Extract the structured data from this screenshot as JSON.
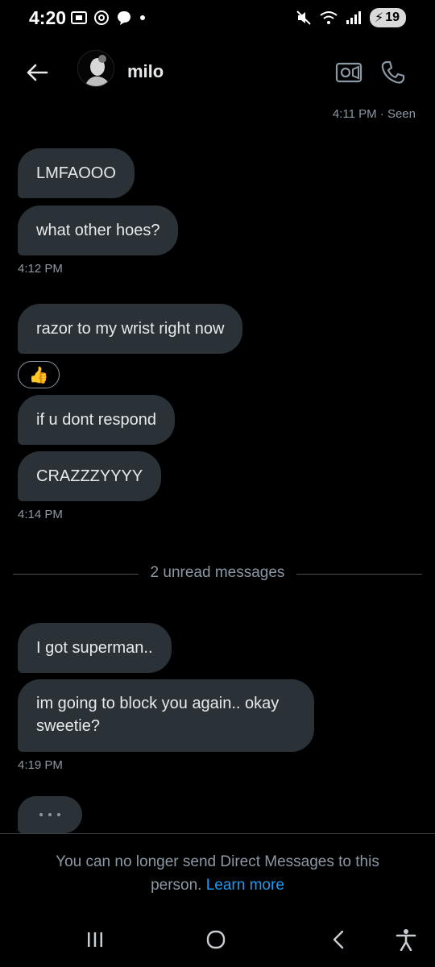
{
  "status_bar": {
    "time": "4:20",
    "battery": "19",
    "left_icons": [
      "screenshot-icon",
      "threads-icon",
      "chat-icon",
      "dot-icon"
    ],
    "right_icons": [
      "mute-icon",
      "wifi-icon",
      "signal-icon",
      "battery-icon"
    ]
  },
  "header": {
    "name": "milo",
    "icons": [
      "back-arrow-icon",
      "video-call-icon",
      "phone-icon"
    ]
  },
  "conversation": {
    "seen_status": "4:11 PM · Seen",
    "messages": [
      {
        "text": "LMFAOOO"
      },
      {
        "text": "what other hoes?"
      },
      {
        "text": "razor to my wrist right now"
      },
      {
        "text": "if u dont respond"
      },
      {
        "text": "CRAZZZYYYY"
      },
      {
        "text": "I got superman.."
      },
      {
        "text": "im going to block you again.. okay sweetie?"
      }
    ],
    "timestamps": [
      "4:12 PM",
      "4:14 PM",
      "4:19 PM"
    ],
    "reaction": "👍",
    "unread_label": "2 unread messages"
  },
  "footer": {
    "notice": "You can no longer send Direct Messages to this person.",
    "learn_more": "Learn more"
  },
  "nav_bar": {
    "buttons": [
      "recents-icon",
      "home-icon",
      "back-icon",
      "accessibility-icon"
    ]
  },
  "colors": {
    "background": "#000000",
    "bubble": "#2a3238",
    "text": "#e7e9ea",
    "muted": "#8b98a5",
    "link": "#1d9bf0"
  }
}
